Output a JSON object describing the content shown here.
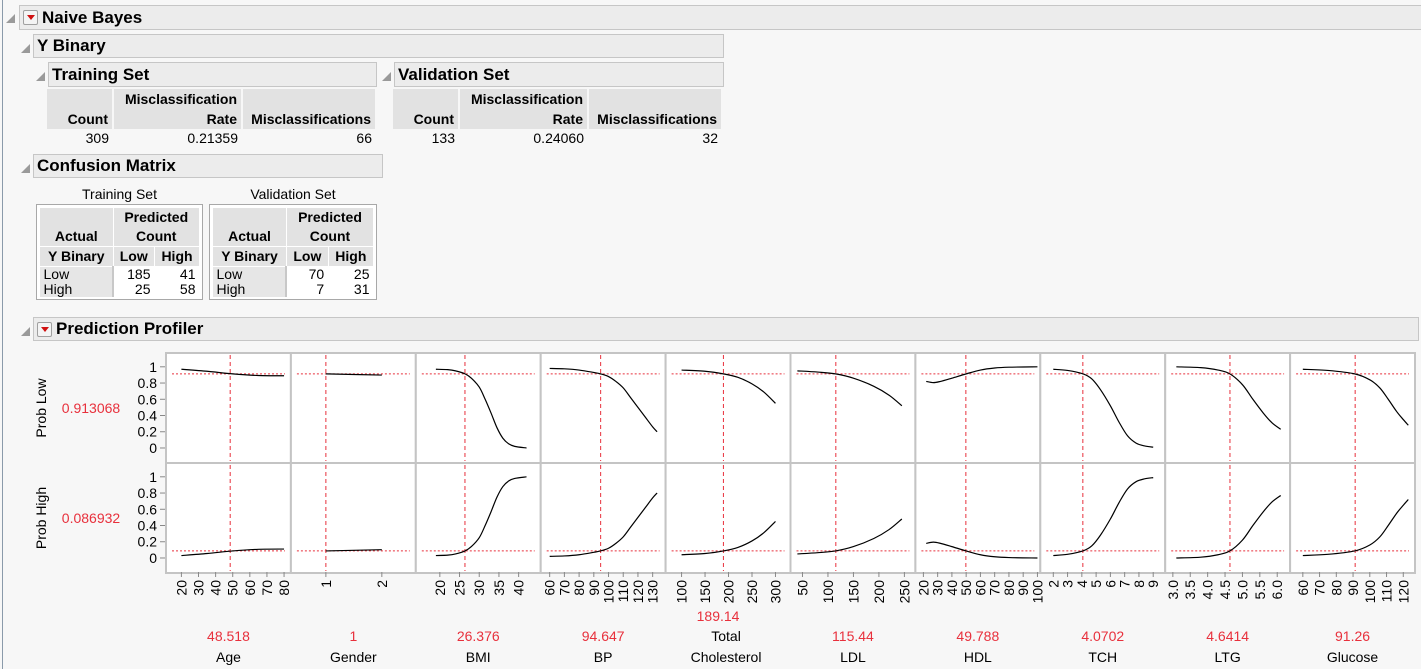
{
  "naive_bayes": {
    "title": "Naive Bayes"
  },
  "y_binary": {
    "title": "Y Binary"
  },
  "fit": {
    "columns": [
      "Count",
      "Misclassification Rate",
      "Misclassifications"
    ],
    "col_line1": [
      "",
      "Misclassification",
      ""
    ],
    "col_line2": [
      "Count",
      "Rate",
      "Misclassifications"
    ],
    "training": {
      "title": "Training Set",
      "count": "309",
      "rate": "0.21359",
      "misclassifications": "66"
    },
    "validation": {
      "title": "Validation Set",
      "count": "133",
      "rate": "0.24060",
      "misclassifications": "32"
    }
  },
  "confusion": {
    "title": "Confusion Matrix",
    "actual": "Actual",
    "predicted": "Predicted",
    "count": "Count",
    "ybinary": "Y Binary",
    "low": "Low",
    "high": "High",
    "training": {
      "title": "Training Set",
      "rows": [
        [
          "Low",
          "185",
          "41"
        ],
        [
          "High",
          "25",
          "58"
        ]
      ]
    },
    "validation": {
      "title": "Validation Set",
      "rows": [
        [
          "Low",
          "70",
          "25"
        ],
        [
          "High",
          "7",
          "31"
        ]
      ]
    }
  },
  "profiler": {
    "title": "Prediction Profiler"
  },
  "chart_data": {
    "type": "line",
    "title": "Prediction Profiler",
    "responses": [
      {
        "name": "Prob Low",
        "value": "0.913068",
        "current": 0.913068
      },
      {
        "name": "Prob High",
        "value": "0.086932",
        "current": 0.086932
      }
    ],
    "ylim": [
      -0.185,
      1.17
    ],
    "yticks": [
      "0",
      "0.2",
      "0.4",
      "0.6",
      "0.8",
      "1"
    ],
    "colors": {
      "ref": "#e8303c",
      "curve": "#000000"
    },
    "factors": [
      {
        "name": "Age",
        "value": "48.518",
        "current": 48.518,
        "xlim": [
          11,
          84
        ],
        "ticks": [
          "20",
          "30",
          "40",
          "50",
          "60",
          "70",
          "80"
        ],
        "curve_low": [
          [
            20,
            0.97
          ],
          [
            35,
            0.945
          ],
          [
            50,
            0.913
          ],
          [
            65,
            0.893
          ],
          [
            80,
            0.89
          ]
        ]
      },
      {
        "name": "Gender",
        "value": "1",
        "current": 1,
        "xlim": [
          0.375,
          2.607
        ],
        "ticks": [
          "1",
          "2"
        ],
        "curve_low": [
          [
            1,
            0.913
          ],
          [
            2,
            0.898
          ]
        ]
      },
      {
        "name": "BMI",
        "value": "26.376",
        "current": 26.376,
        "xlim": [
          13.9,
          45.6
        ],
        "ticks": [
          "20",
          "25",
          "30",
          "35",
          "40"
        ],
        "curve_low": [
          [
            19,
            0.97
          ],
          [
            22,
            0.965
          ],
          [
            24,
            0.95
          ],
          [
            26.4,
            0.913
          ],
          [
            28,
            0.86
          ],
          [
            30,
            0.75
          ],
          [
            31.5,
            0.6
          ],
          [
            33,
            0.43
          ],
          [
            34.5,
            0.25
          ],
          [
            36,
            0.12
          ],
          [
            37.5,
            0.05
          ],
          [
            39,
            0.02
          ],
          [
            42,
            0.0
          ]
        ]
      },
      {
        "name": "BP",
        "value": "94.647",
        "current": 94.647,
        "xlim": [
          53.9,
          138.8
        ],
        "ticks": [
          "60",
          "70",
          "80",
          "90",
          "100",
          "110",
          "120",
          "130"
        ],
        "curve_low": [
          [
            60,
            0.98
          ],
          [
            70,
            0.975
          ],
          [
            80,
            0.96
          ],
          [
            90,
            0.93
          ],
          [
            94.6,
            0.913
          ],
          [
            100,
            0.88
          ],
          [
            105,
            0.82
          ],
          [
            110,
            0.74
          ],
          [
            115,
            0.62
          ],
          [
            120,
            0.5
          ],
          [
            125,
            0.38
          ],
          [
            130,
            0.26
          ],
          [
            133,
            0.2
          ]
        ]
      },
      {
        "name": "Total Cholesterol",
        "name_lines": [
          "Total",
          "Cholesterol"
        ],
        "value": "189.14",
        "current": 189.14,
        "xlim": [
          66,
          332
        ],
        "ticks": [
          "100",
          "150",
          "200",
          "250",
          "300"
        ],
        "curve_low": [
          [
            100,
            0.96
          ],
          [
            150,
            0.945
          ],
          [
            189,
            0.913
          ],
          [
            220,
            0.87
          ],
          [
            250,
            0.79
          ],
          [
            275,
            0.69
          ],
          [
            300,
            0.55
          ]
        ]
      },
      {
        "name": "LDL",
        "value": "115.44",
        "current": 115.44,
        "xlim": [
          26.5,
          271.6
        ],
        "ticks": [
          "50",
          "100",
          "150",
          "200",
          "250"
        ],
        "curve_low": [
          [
            40,
            0.95
          ],
          [
            80,
            0.935
          ],
          [
            115,
            0.913
          ],
          [
            150,
            0.86
          ],
          [
            190,
            0.76
          ],
          [
            220,
            0.65
          ],
          [
            245,
            0.52
          ]
        ]
      },
      {
        "name": "HDL",
        "value": "49.788",
        "current": 49.788,
        "xlim": [
          14.4,
          102
        ],
        "ticks": [
          "20",
          "30",
          "40",
          "50",
          "60",
          "70",
          "80",
          "90",
          "100"
        ],
        "curve_low": [
          [
            22,
            0.82
          ],
          [
            27,
            0.805
          ],
          [
            32,
            0.82
          ],
          [
            40,
            0.86
          ],
          [
            50,
            0.913
          ],
          [
            60,
            0.96
          ],
          [
            70,
            0.985
          ],
          [
            80,
            0.995
          ],
          [
            100,
            1.0
          ]
        ]
      },
      {
        "name": "TCH",
        "value": "4.0702",
        "current": 4.0702,
        "xlim": [
          1.09,
          9.84
        ],
        "ticks": [
          "2",
          "3",
          "4",
          "5",
          "6",
          "7",
          "8",
          "9"
        ],
        "curve_low": [
          [
            2,
            0.97
          ],
          [
            3,
            0.955
          ],
          [
            4.07,
            0.913
          ],
          [
            4.7,
            0.85
          ],
          [
            5.3,
            0.72
          ],
          [
            6,
            0.52
          ],
          [
            6.6,
            0.32
          ],
          [
            7.2,
            0.15
          ],
          [
            7.8,
            0.06
          ],
          [
            8.4,
            0.025
          ],
          [
            9,
            0.01
          ]
        ]
      },
      {
        "name": "LTG",
        "value": "4.6414",
        "current": 4.6414,
        "xlim": [
          2.78,
          6.37
        ],
        "ticks": [
          "3.0",
          "3.5",
          "4.0",
          "4.5",
          "5.0",
          "5.5",
          "6.0"
        ],
        "curve_low": [
          [
            3.1,
            1.0
          ],
          [
            3.8,
            0.99
          ],
          [
            4.3,
            0.96
          ],
          [
            4.64,
            0.913
          ],
          [
            5.0,
            0.78
          ],
          [
            5.3,
            0.6
          ],
          [
            5.6,
            0.43
          ],
          [
            5.85,
            0.31
          ],
          [
            6.1,
            0.23
          ]
        ]
      },
      {
        "name": "Glucose",
        "value": "91.26",
        "current": 91.26,
        "xlim": [
          52.4,
          127
        ],
        "ticks": [
          "60",
          "70",
          "80",
          "90",
          "100",
          "110",
          "120"
        ],
        "curve_low": [
          [
            60,
            0.97
          ],
          [
            75,
            0.955
          ],
          [
            91,
            0.913
          ],
          [
            100,
            0.84
          ],
          [
            106,
            0.74
          ],
          [
            111,
            0.6
          ],
          [
            116,
            0.45
          ],
          [
            120,
            0.35
          ],
          [
            123,
            0.28
          ]
        ]
      }
    ]
  }
}
